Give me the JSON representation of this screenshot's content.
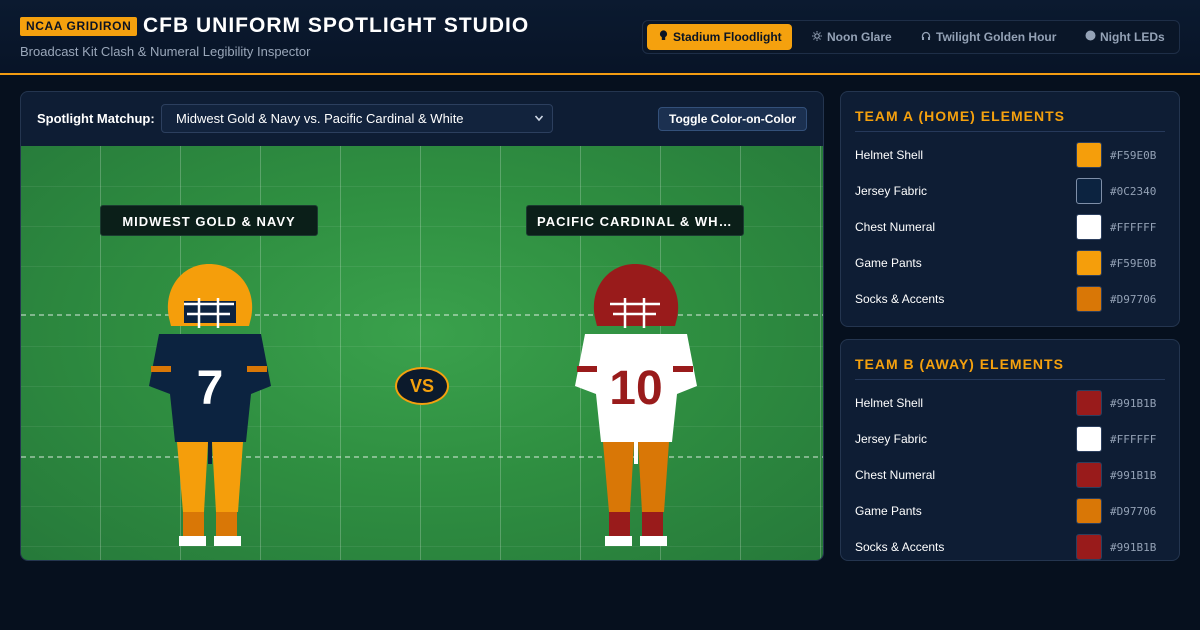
{
  "header": {
    "badge": "NCAA GRIDIRON",
    "title": "CFB UNIFORM SPOTLIGHT STUDIO",
    "subtitle": "Broadcast Kit Clash & Numeral Legibility Inspector"
  },
  "lighting_modes": [
    {
      "label": "Stadium Floodlight",
      "icon": "lightbulb-icon",
      "active": true
    },
    {
      "label": "Noon Glare",
      "icon": "sun-icon",
      "active": false
    },
    {
      "label": "Twilight Golden Hour",
      "icon": "headphones-icon",
      "active": false
    },
    {
      "label": "Night LEDs",
      "icon": "circle-icon",
      "active": false
    }
  ],
  "toolbar": {
    "matchup_label": "Spotlight Matchup:",
    "matchup_value": "Midwest Gold & Navy vs. Pacific Cardinal & White",
    "toggle_label": "Toggle Color-on-Color"
  },
  "field": {
    "team_a_label": "MIDWEST GOLD & NAVY",
    "team_b_label": "PACIFIC CARDINAL & WHITE",
    "vs": "VS",
    "team_a_number": "7",
    "team_b_number": "10"
  },
  "team_a": {
    "title": "TEAM A (HOME) ELEMENTS",
    "elements": [
      {
        "label": "Helmet Shell",
        "color": "#F59E0B"
      },
      {
        "label": "Jersey Fabric",
        "color": "#0C2340"
      },
      {
        "label": "Chest Numeral",
        "color": "#FFFFFF"
      },
      {
        "label": "Game Pants",
        "color": "#F59E0B"
      },
      {
        "label": "Socks & Accents",
        "color": "#D97706"
      }
    ]
  },
  "team_b": {
    "title": "TEAM B (AWAY) ELEMENTS",
    "elements": [
      {
        "label": "Helmet Shell",
        "color": "#991B1B"
      },
      {
        "label": "Jersey Fabric",
        "color": "#FFFFFF"
      },
      {
        "label": "Chest Numeral",
        "color": "#991B1B"
      },
      {
        "label": "Game Pants",
        "color": "#D97706"
      },
      {
        "label": "Socks & Accents",
        "color": "#991B1B"
      }
    ]
  },
  "colors": {
    "accent": "#F5A10E",
    "field_green": "#2F8F41",
    "team_a_facemask": "#FFFFFF",
    "team_b_facemask": "#FFFFFF",
    "team_a_stripe": "#D97706",
    "team_b_stripe": "#991B1B"
  }
}
